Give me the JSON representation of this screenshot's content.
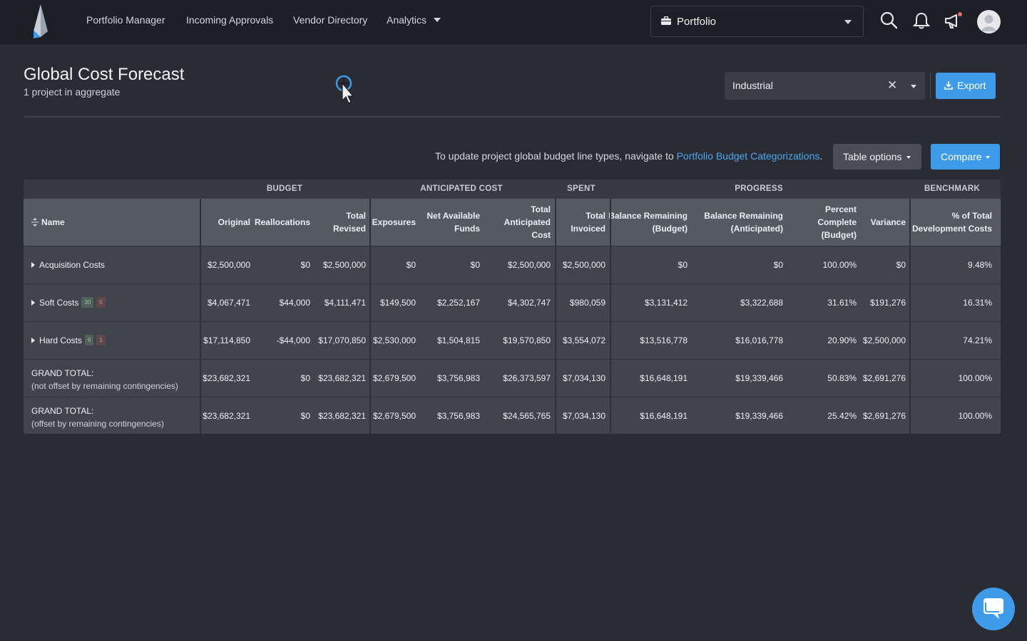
{
  "nav": {
    "items": [
      "Portfolio Manager",
      "Incoming Approvals",
      "Vendor Directory",
      "Analytics"
    ],
    "portfolio_select": "Portfolio"
  },
  "header": {
    "title": "Global Cost Forecast",
    "subtitle": "1 project in aggregate",
    "filter_value": "Industrial",
    "clear_symbol": "✕",
    "export_label": "Export"
  },
  "toolbar": {
    "hint_text": "To update project global budget line types, navigate to ",
    "hint_link": "Portfolio Budget Categorizations",
    "hint_end": ".",
    "table_options_label": "Table options",
    "compare_label": "Compare"
  },
  "table": {
    "groups": [
      "BUDGET",
      "ANTICIPATED COST",
      "SPENT",
      "PROGRESS",
      "BENCHMARK"
    ],
    "columns": [
      [
        "Original"
      ],
      [
        "Reallocations"
      ],
      [
        "Total",
        "Revised"
      ],
      [
        "Exposures"
      ],
      [
        "Net Available",
        "Funds"
      ],
      [
        "Total",
        "Anticipated",
        "Cost"
      ],
      [
        "Total",
        "Invoiced"
      ],
      [
        "Balance Remaining",
        "(Budget)"
      ],
      [
        "Balance Remaining",
        "(Anticipated)"
      ],
      [
        "Percent",
        "Complete",
        "(Budget)"
      ],
      [
        "Variance"
      ],
      [
        "% of Total",
        "Development Costs"
      ]
    ],
    "name_header": "Name",
    "rows": [
      {
        "name": "Acquisition Costs",
        "badges": [],
        "values": [
          "$2,500,000",
          "$0",
          "$2,500,000",
          "$0",
          "$0",
          "$2,500,000",
          "$2,500,000",
          "$0",
          "$0",
          "100.00%",
          "$0",
          "9.48%"
        ]
      },
      {
        "name": "Soft Costs",
        "badges": [
          "30",
          "5"
        ],
        "values": [
          "$4,067,471",
          "$44,000",
          "$4,111,471",
          "$149,500",
          "$2,252,167",
          "$4,302,747",
          "$980,059",
          "$3,131,412",
          "$3,322,688",
          "31.61%",
          "$191,276",
          "16.31%"
        ]
      },
      {
        "name": "Hard Costs",
        "badges": [
          "6",
          "1"
        ],
        "values": [
          "$17,114,850",
          "-$44,000",
          "$17,070,850",
          "$2,530,000",
          "$1,504,815",
          "$19,570,850",
          "$3,554,072",
          "$13,516,778",
          "$16,016,778",
          "20.90%",
          "$2,500,000",
          "74.21%"
        ]
      },
      {
        "name": "GRAND TOTAL:",
        "sub": "(not offset by remaining contingencies)",
        "values": [
          "$23,682,321",
          "$0",
          "$23,682,321",
          "$2,679,500",
          "$3,756,983",
          "$26,373,597",
          "$7,034,130",
          "$16,648,191",
          "$19,339,466",
          "50.83%",
          "$2,691,276",
          "100.00%"
        ]
      },
      {
        "name": "GRAND TOTAL:",
        "sub": "(offset by remaining contingencies)",
        "values": [
          "$23,682,321",
          "$0",
          "$23,682,321",
          "$2,679,500",
          "$3,756,983",
          "$24,565,765",
          "$7,034,130",
          "$16,648,191",
          "$19,339,466",
          "25.42%",
          "$2,691,276",
          "100.00%"
        ]
      }
    ]
  },
  "colors": {
    "accent": "#3d9be9",
    "background": "#2a2b33",
    "topbar": "#1e1f24"
  }
}
